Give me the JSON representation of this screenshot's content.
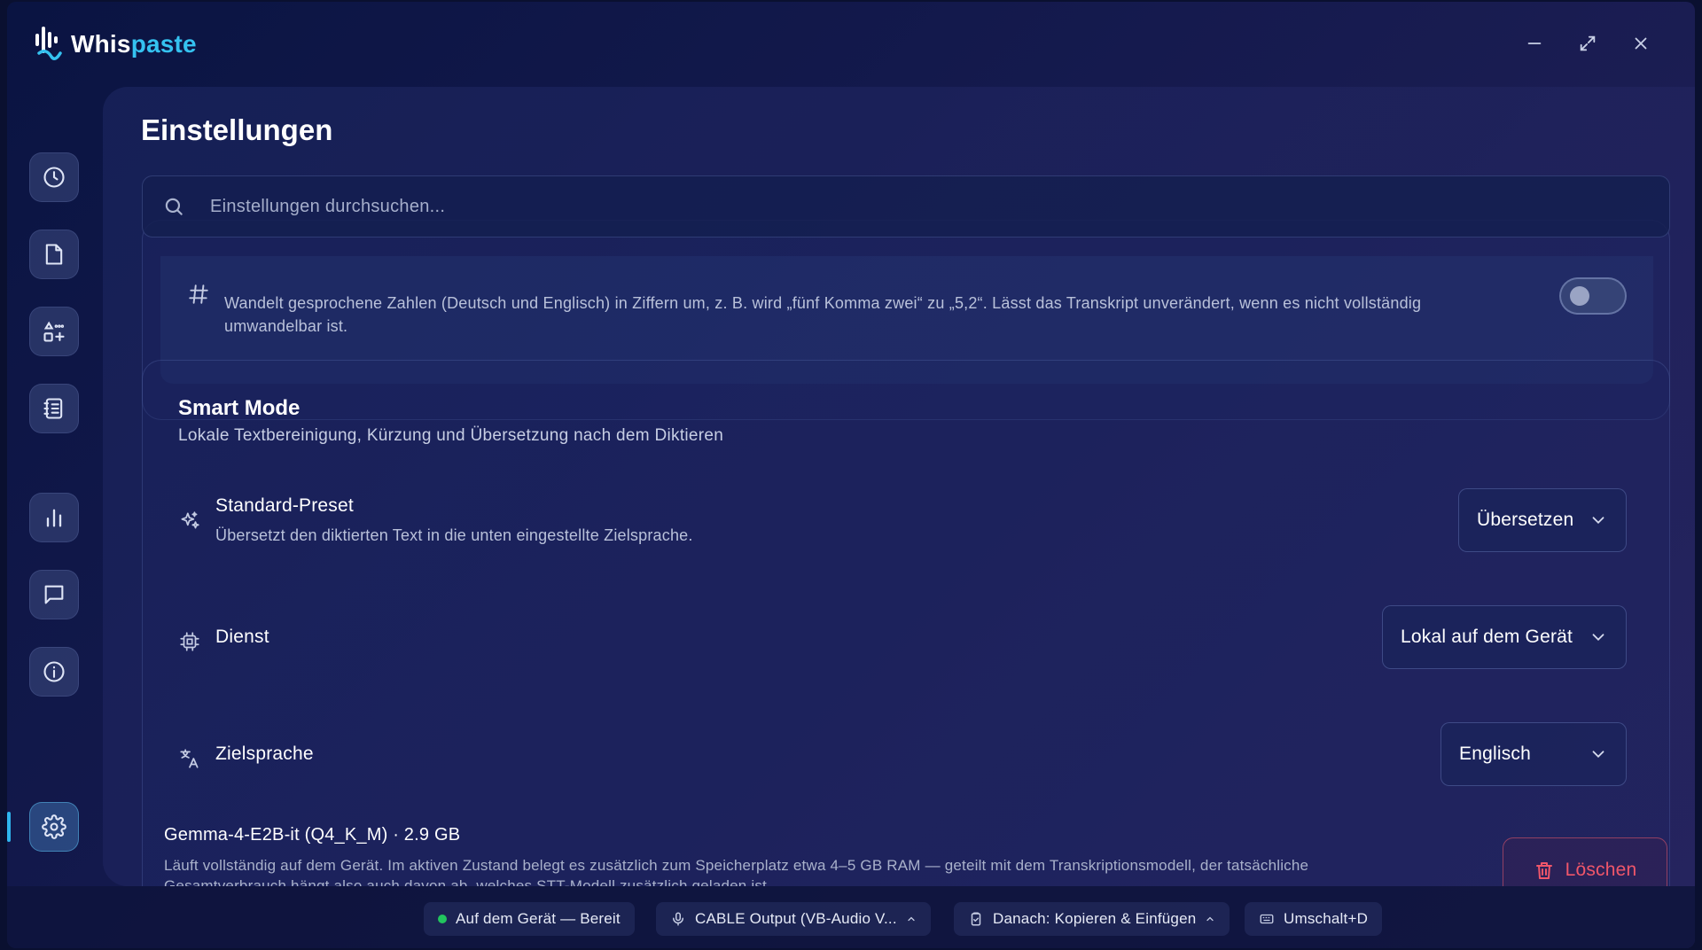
{
  "app": {
    "logo_text_1": "Whis",
    "logo_text_2": "paste",
    "accent_color": "#35c2f0"
  },
  "window_controls": [
    "minimize-icon",
    "maximize-icon",
    "close-icon"
  ],
  "sidebar": {
    "items": [
      {
        "name": "history",
        "icon": "clock-icon"
      },
      {
        "name": "files",
        "icon": "file-icon"
      },
      {
        "name": "transform",
        "icon": "shapes-icon"
      },
      {
        "name": "notes",
        "icon": "notebook-icon"
      },
      {
        "name": "stats",
        "icon": "bar-chart-icon"
      },
      {
        "name": "chat",
        "icon": "chat-icon"
      },
      {
        "name": "info",
        "icon": "info-icon"
      },
      {
        "name": "settings",
        "icon": "gear-icon",
        "active": true
      }
    ]
  },
  "page": {
    "title": "Einstellungen"
  },
  "search": {
    "placeholder": "Einstellungen durchsuchen..."
  },
  "number_conversion": {
    "description": "Wandelt gesprochene Zahlen (Deutsch und Englisch) in Ziffern um, z. B. wird „fünf Komma zwei“ zu „5,2“. Lässt das Transkript unverändert, wenn es nicht vollständig umwandelbar ist.",
    "enabled": false
  },
  "smart_mode": {
    "title": "Smart Mode",
    "subtitle": "Lokale Textbereinigung, Kürzung und Übersetzung nach dem Diktieren",
    "preset": {
      "label": "Standard-Preset",
      "description": "Übersetzt den diktierten Text in die unten eingestellte Zielsprache.",
      "value": "Übersetzen"
    },
    "service": {
      "label": "Dienst",
      "value": "Lokal auf dem Gerät"
    },
    "target_language": {
      "label": "Zielsprache",
      "value": "Englisch"
    },
    "model": {
      "title": "Gemma-4-E2B-it (Q4_K_M) · 2.9 GB",
      "description": "Läuft vollständig auf dem Gerät. Im aktiven Zustand belegt es zusätzlich zum Speicherplatz etwa 4–5 GB RAM — geteilt mit dem Transkriptionsmodell, der tatsächliche Gesamtverbrauch hängt also auch davon ab, welches STT-Modell zusätzlich geladen ist.",
      "delete_label": "Löschen"
    }
  },
  "statusbar": {
    "status": "Auf dem Gerät — Bereit",
    "status_color": "#22c55e",
    "microphone": "CABLE Output (VB-Audio V...",
    "after_action": "Danach: Kopieren & Einfügen",
    "hotkey": "Umschalt+D"
  }
}
